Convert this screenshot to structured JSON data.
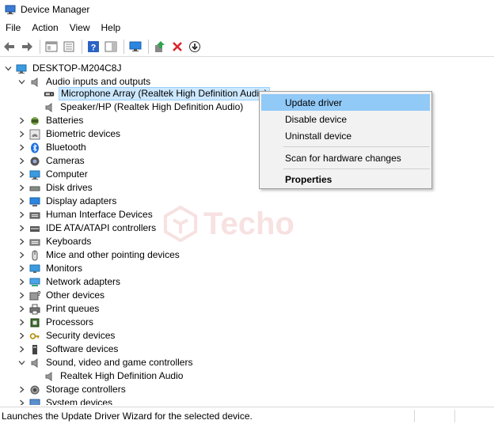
{
  "window": {
    "title": "Device Manager",
    "icon": "device-manager-icon"
  },
  "menu": [
    "File",
    "Action",
    "View",
    "Help"
  ],
  "toolbar": {
    "buttons": [
      "back-arrow",
      "forward-arrow",
      "properties-panel",
      "show-hidden",
      "help",
      "action-pane",
      "monitor-scan",
      "update-driver",
      "uninstall-x",
      "disable-down-arrow"
    ]
  },
  "tree": {
    "root": "DESKTOP-M204C8J",
    "audio": {
      "label": "Audio inputs and outputs",
      "children": [
        "Microphone Array (Realtek High Definition Audio)",
        "Speaker/HP (Realtek High Definition Audio)"
      ]
    },
    "categories_a": [
      "Batteries",
      "Biometric devices",
      "Bluetooth",
      "Cameras",
      "Computer",
      "Disk drives",
      "Display adapters",
      "Human Interface Devices",
      "IDE ATA/ATAPI controllers",
      "Keyboards",
      "Mice and other pointing devices",
      "Monitors",
      "Network adapters",
      "Other devices",
      "Print queues",
      "Processors",
      "Security devices",
      "Software devices"
    ],
    "sound": {
      "label": "Sound, video and game controllers",
      "children": [
        "Realtek High Definition Audio"
      ]
    },
    "categories_b": [
      "Storage controllers",
      "System devices"
    ]
  },
  "context_menu": {
    "update": "Update driver",
    "disable": "Disable device",
    "uninstall": "Uninstall device",
    "scan": "Scan for hardware changes",
    "properties": "Properties"
  },
  "watermark": "Techo",
  "status": "Launches the Update Driver Wizard for the selected device.",
  "colors": {
    "selection": "#cce8ff",
    "menu_highlight": "#91c9f7",
    "accent": "#0078d7"
  }
}
